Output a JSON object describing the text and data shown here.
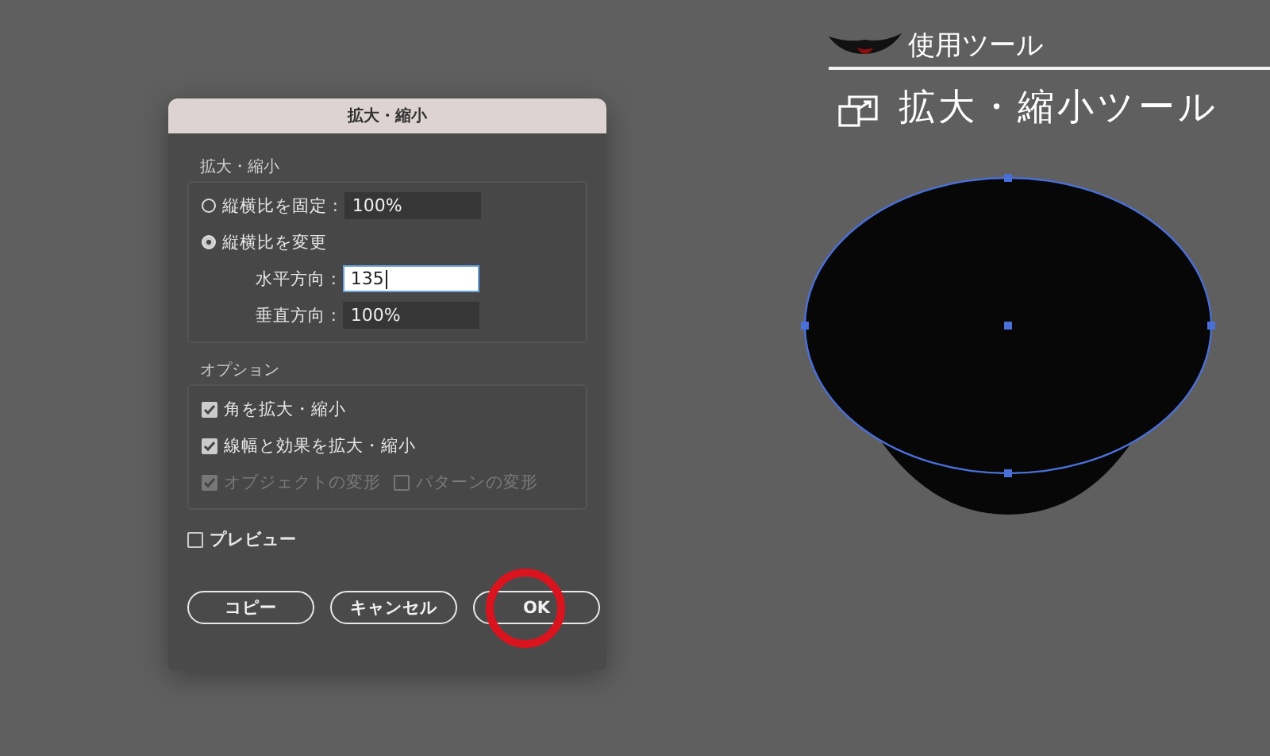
{
  "tool_header": {
    "label": "使用ツール",
    "tool_name": "拡大・縮小ツール"
  },
  "dialog": {
    "title": "拡大・縮小",
    "scale_group": {
      "label": "拡大・縮小",
      "modes": [
        {
          "label": "縦横比を固定 :",
          "selected": false,
          "value": "100%"
        },
        {
          "label": "縦横比を変更",
          "selected": true
        }
      ],
      "fields": [
        {
          "label": "水平方向 :",
          "value": "135",
          "focused": true
        },
        {
          "label": "垂直方向 :",
          "value": "100%",
          "focused": false
        }
      ]
    },
    "options_group": {
      "label": "オプション",
      "rows": [
        {
          "items": [
            {
              "label": "角を拡大・縮小",
              "checked": true,
              "disabled": false
            }
          ]
        },
        {
          "items": [
            {
              "label": "線幅と効果を拡大・縮小",
              "checked": true,
              "disabled": false
            }
          ]
        },
        {
          "items": [
            {
              "label": "オブジェクトの変形",
              "checked": true,
              "disabled": true
            },
            {
              "label": "パターンの変形",
              "checked": false,
              "disabled": true
            }
          ]
        }
      ]
    },
    "preview": {
      "label": "プレビュー",
      "checked": false
    },
    "buttons": [
      {
        "label": "コピー",
        "highlighted": false
      },
      {
        "label": "キャンセル",
        "highlighted": false
      },
      {
        "label": "OK",
        "highlighted": true
      }
    ]
  }
}
